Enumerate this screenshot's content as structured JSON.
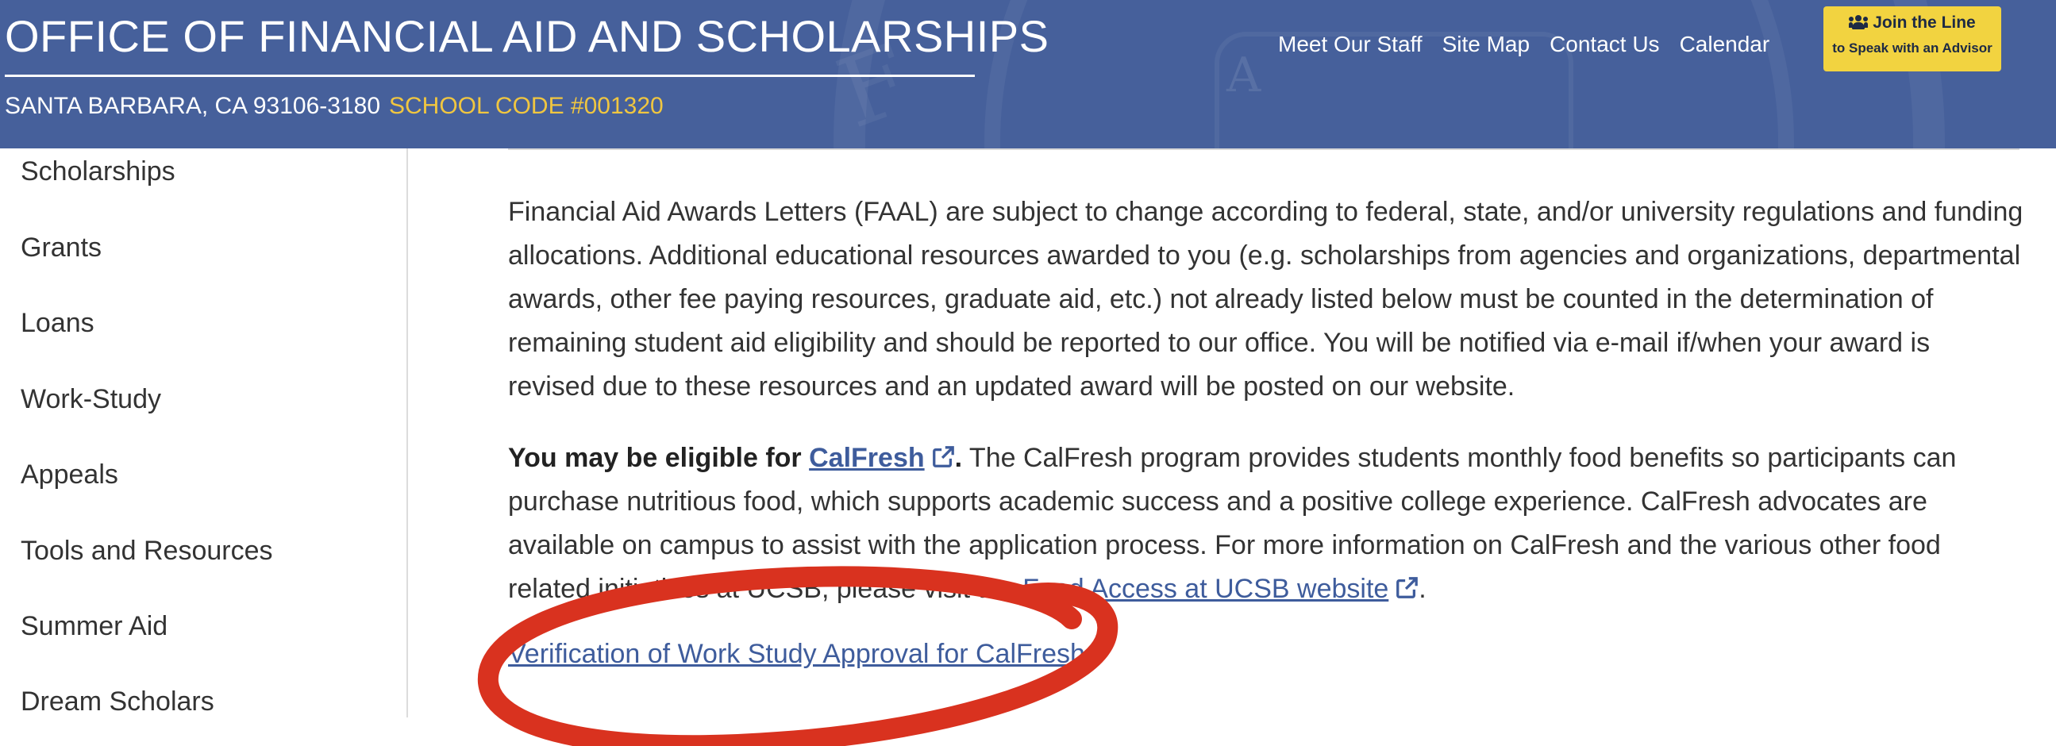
{
  "header": {
    "title": "OFFICE OF FINANCIAL AID AND SCHOLARSHIPS",
    "address": "SANTA BARBARA, CA 93106-3180",
    "school_code": "SCHOOL CODE #001320",
    "nav": [
      "Meet Our Staff",
      "Site Map",
      "Contact Us",
      "Calendar"
    ],
    "join_button": {
      "line1": "Join the Line",
      "line2": "to Speak with an Advisor",
      "icon": "users-icon"
    },
    "background_color": "#46609b",
    "accent_color": "#f0c640"
  },
  "sidebar": {
    "items": [
      "Scholarships",
      "Grants",
      "Loans",
      "Work-Study",
      "Appeals",
      "Tools and Resources",
      "Summer Aid",
      "Dream Scholars"
    ]
  },
  "main": {
    "paragraph1": "Financial Aid Awards Letters (FAAL) are subject to change according to federal, state, and/or university regulations and funding allocations. Additional educational resources awarded to you (e.g. scholarships from agencies and organizations, departmental awards, other fee paying resources, graduate aid, etc.) not already listed below must be counted in the determination of remaining student aid eligibility and should be reported to our office. You will be notified via e-mail if/when your award is revised due to these resources and an updated award will be posted on our website.",
    "eligible_prefix": "You may be eligible for",
    "calfresh_link": "CalFresh",
    "eligible_dot": ".",
    "paragraph2_body": "The CalFresh program provides students monthly food benefits so participants can purchase nutritious food, which supports academic success and a positive college experience. CalFresh advocates are available on campus to assist with the application process. For more information on CalFresh and the various other food related initiatives at UCSB, please visit the",
    "food_access_link": "Food Access at UCSB website",
    "paragraph2_end": ".",
    "verification_link": "Verification of Work Study Approval for CalFresh",
    "link_color": "#3e5c9c",
    "annotation_color": "#d9321f"
  }
}
